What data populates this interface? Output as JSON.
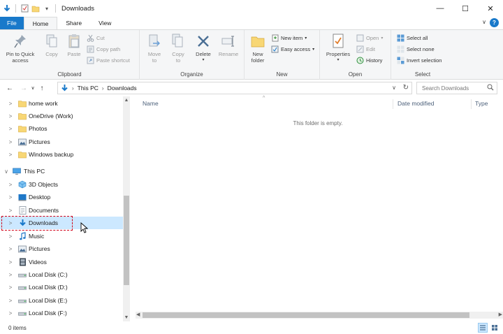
{
  "window": {
    "title": "Downloads",
    "controls": {
      "minimize": "—",
      "maximize": "☐",
      "close": "✕"
    }
  },
  "tabs": {
    "file": "File",
    "home": "Home",
    "share": "Share",
    "view": "View"
  },
  "ribbon": {
    "clipboard": {
      "label": "Clipboard",
      "pin_line1": "Pin to Quick",
      "pin_line2": "access",
      "copy": "Copy",
      "paste": "Paste",
      "cut": "Cut",
      "copy_path": "Copy path",
      "paste_shortcut": "Paste shortcut"
    },
    "organize": {
      "label": "Organize",
      "move_line1": "Move",
      "move_line2": "to",
      "copy_line1": "Copy",
      "copy_line2": "to",
      "delete": "Delete",
      "rename": "Rename"
    },
    "new": {
      "label": "New",
      "new_folder_line1": "New",
      "new_folder_line2": "folder",
      "new_item": "New item",
      "easy_access": "Easy access"
    },
    "open": {
      "label": "Open",
      "properties": "Properties",
      "open": "Open",
      "edit": "Edit",
      "history": "History"
    },
    "select": {
      "label": "Select",
      "select_all": "Select all",
      "select_none": "Select none",
      "invert_selection": "Invert selection"
    }
  },
  "address": {
    "crumbs": [
      "This PC",
      "Downloads"
    ],
    "search_placeholder": "Search Downloads"
  },
  "nav_tree": {
    "items": [
      {
        "label": "home work",
        "icon": "folder-icon"
      },
      {
        "label": "OneDrive (Work)",
        "icon": "folder-icon"
      },
      {
        "label": "Photos",
        "icon": "folder-icon"
      },
      {
        "label": "Pictures",
        "icon": "pictures-icon"
      },
      {
        "label": "Windows backup",
        "icon": "folder-icon"
      },
      {
        "label": "This PC",
        "icon": "computer-icon"
      },
      {
        "label": "3D Objects",
        "icon": "3d-objects-icon"
      },
      {
        "label": "Desktop",
        "icon": "desktop-icon"
      },
      {
        "label": "Documents",
        "icon": "documents-icon"
      },
      {
        "label": "Downloads",
        "icon": "download-arrow-icon"
      },
      {
        "label": "Music",
        "icon": "music-icon"
      },
      {
        "label": "Pictures",
        "icon": "pictures-icon"
      },
      {
        "label": "Videos",
        "icon": "videos-icon"
      },
      {
        "label": "Local Disk (C:)",
        "icon": "drive-icon"
      },
      {
        "label": "Local Disk (D:)",
        "icon": "drive-icon"
      },
      {
        "label": "Local Disk (E:)",
        "icon": "drive-icon"
      },
      {
        "label": "Local Disk (F:)",
        "icon": "drive-icon"
      }
    ]
  },
  "file_list": {
    "columns": {
      "name": "Name",
      "date_modified": "Date modified",
      "type": "Type"
    },
    "empty_message": "This folder is empty."
  },
  "status": {
    "item_count": "0 items"
  },
  "colors": {
    "accent": "#1979ca",
    "selection": "#cce8ff",
    "highlight_box": "#d0021b",
    "folder": "#f8d775"
  }
}
